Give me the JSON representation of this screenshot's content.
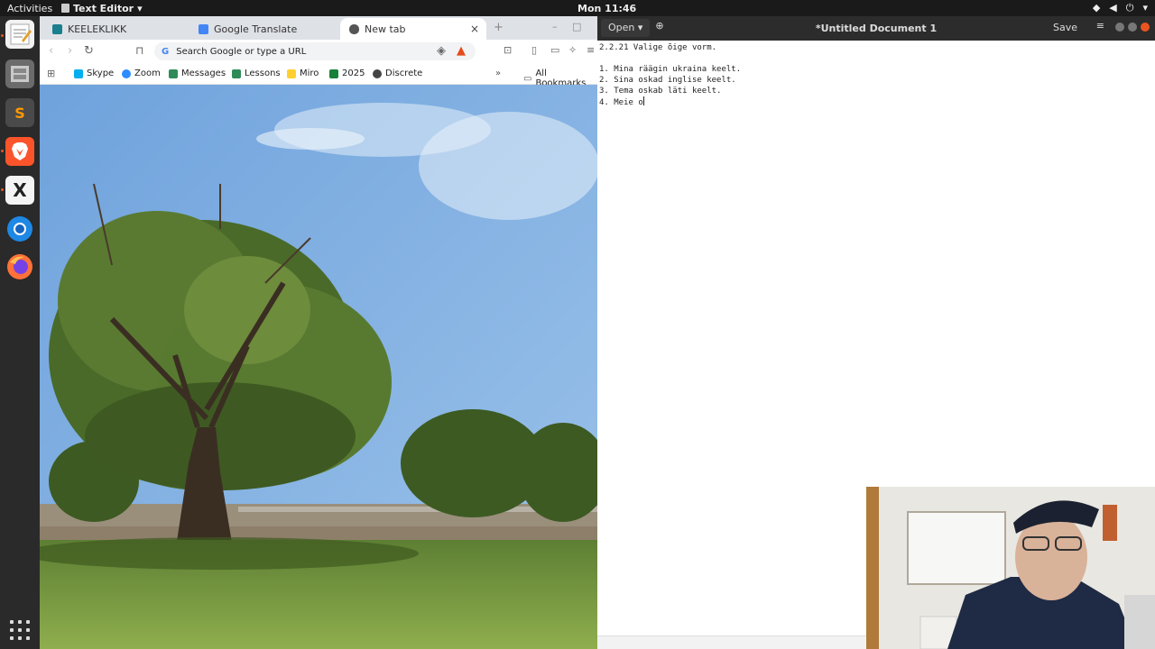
{
  "topbar": {
    "activities": "Activities",
    "app_name": "Text Editor",
    "clock": "Mon 11:46"
  },
  "dock": {
    "items": [
      "text-editor",
      "file-cabinet",
      "sublime-text",
      "brave-browser",
      "xournal",
      "chromium",
      "firefox"
    ]
  },
  "browser": {
    "tabs": [
      {
        "label": "KEELEKLIKK",
        "color": "#1a7f8e"
      },
      {
        "label": "Google Translate",
        "color": "#4285f4"
      },
      {
        "label": "New tab",
        "color": "#555555"
      }
    ],
    "omnibox": {
      "placeholder": "Search Google or type a URL"
    },
    "bookmarks": [
      {
        "label": "Skype",
        "color": "#00aff0"
      },
      {
        "label": "Zoom",
        "color": "#2d8cff"
      },
      {
        "label": "Messages",
        "color": "#2e8b57"
      },
      {
        "label": "Lessons",
        "color": "#2e8b57"
      },
      {
        "label": "Miro",
        "color": "#ffd02f"
      },
      {
        "label": "2025",
        "color": "#188038"
      },
      {
        "label": "Discrete",
        "color": "#444444"
      }
    ],
    "all_bookmarks": "All Bookmarks"
  },
  "editor": {
    "open_label": "Open",
    "title": "*Untitled Document 1",
    "save_label": "Save",
    "lines": [
      "2.2.21 Valige õige vorm.",
      "",
      "1. Mina räägin ukraina keelt.",
      "2. Sina oskad inglise keelt.",
      "3. Tema oskab läti keelt.",
      "4. Meie o"
    ]
  }
}
